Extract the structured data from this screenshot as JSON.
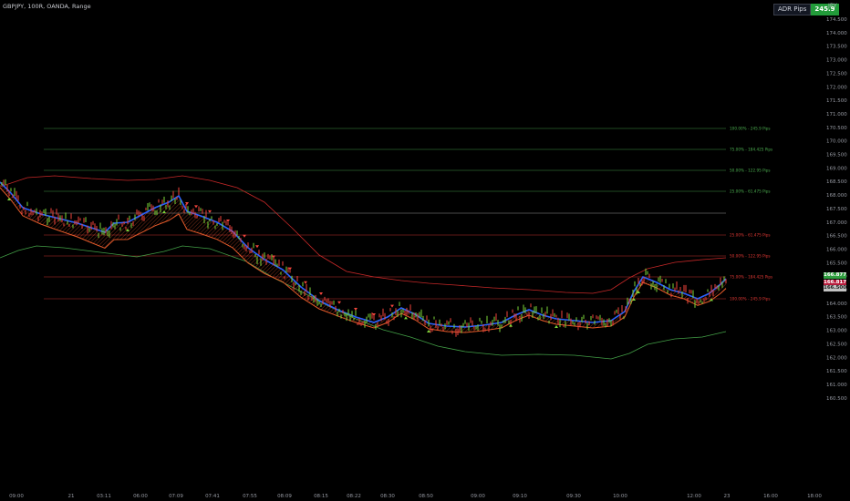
{
  "header": {
    "title": "GBPJPY, 100R, OANDA, Range",
    "currency": "JPY"
  },
  "adr": {
    "label": "ADR Pips",
    "value": "245.9"
  },
  "price_axis": {
    "labels": [
      "174.500",
      "174.000",
      "173.500",
      "173.000",
      "172.500",
      "172.000",
      "171.500",
      "171.000",
      "170.500",
      "170.000",
      "169.500",
      "169.000",
      "168.500",
      "168.000",
      "167.500",
      "167.000",
      "166.500",
      "166.000",
      "165.500",
      "165.000",
      "164.500",
      "164.000",
      "163.500",
      "163.000",
      "162.500",
      "162.000",
      "161.500",
      "161.000",
      "160.500"
    ]
  },
  "price_tags": [
    {
      "text": "166.877",
      "color": "#2e9e3e"
    },
    {
      "text": "166.817",
      "color": "#d7d7d7"
    },
    {
      "text": "166.500",
      "color": "#c2c2c2"
    }
  ],
  "time_axis": {
    "labels": [
      "09:00",
      "21",
      "03:11",
      "06:00",
      "07:09",
      "07:41",
      "07:55",
      "08:09",
      "08:15",
      "08:22",
      "08:30",
      "08:50",
      "09:00",
      "09:10",
      "09:30",
      "10:00",
      "12:00",
      "23",
      "16:00",
      "18:00"
    ]
  },
  "adr_levels": [
    {
      "label": "100.00% - 245.9 Pips",
      "color": "#4caf50"
    },
    {
      "label": "75.00% - 184.425 Pips",
      "color": "#4caf50"
    },
    {
      "label": "50.00% - 122.95 Pips",
      "color": "#4caf50"
    },
    {
      "label": "25.00% - 61.475 Pips",
      "color": "#4caf50"
    },
    {
      "label": "",
      "color": "#b0b0b0"
    },
    {
      "label": "25.00% - 61.475 Pips",
      "color": "#e53935"
    },
    {
      "label": "50.00% - 122.95 Pips",
      "color": "#e53935"
    },
    {
      "label": "75.00% - 184.425 Pips",
      "color": "#e53935"
    },
    {
      "label": "100.00% - 245.9 Pips",
      "color": "#e53935"
    }
  ],
  "colors": {
    "up": "#7bd63a",
    "down": "#f2453d",
    "ma_fast": "#2962ff",
    "band": "#e35a2a",
    "upper_env": "#c62828",
    "lower_env": "#43a047"
  }
}
